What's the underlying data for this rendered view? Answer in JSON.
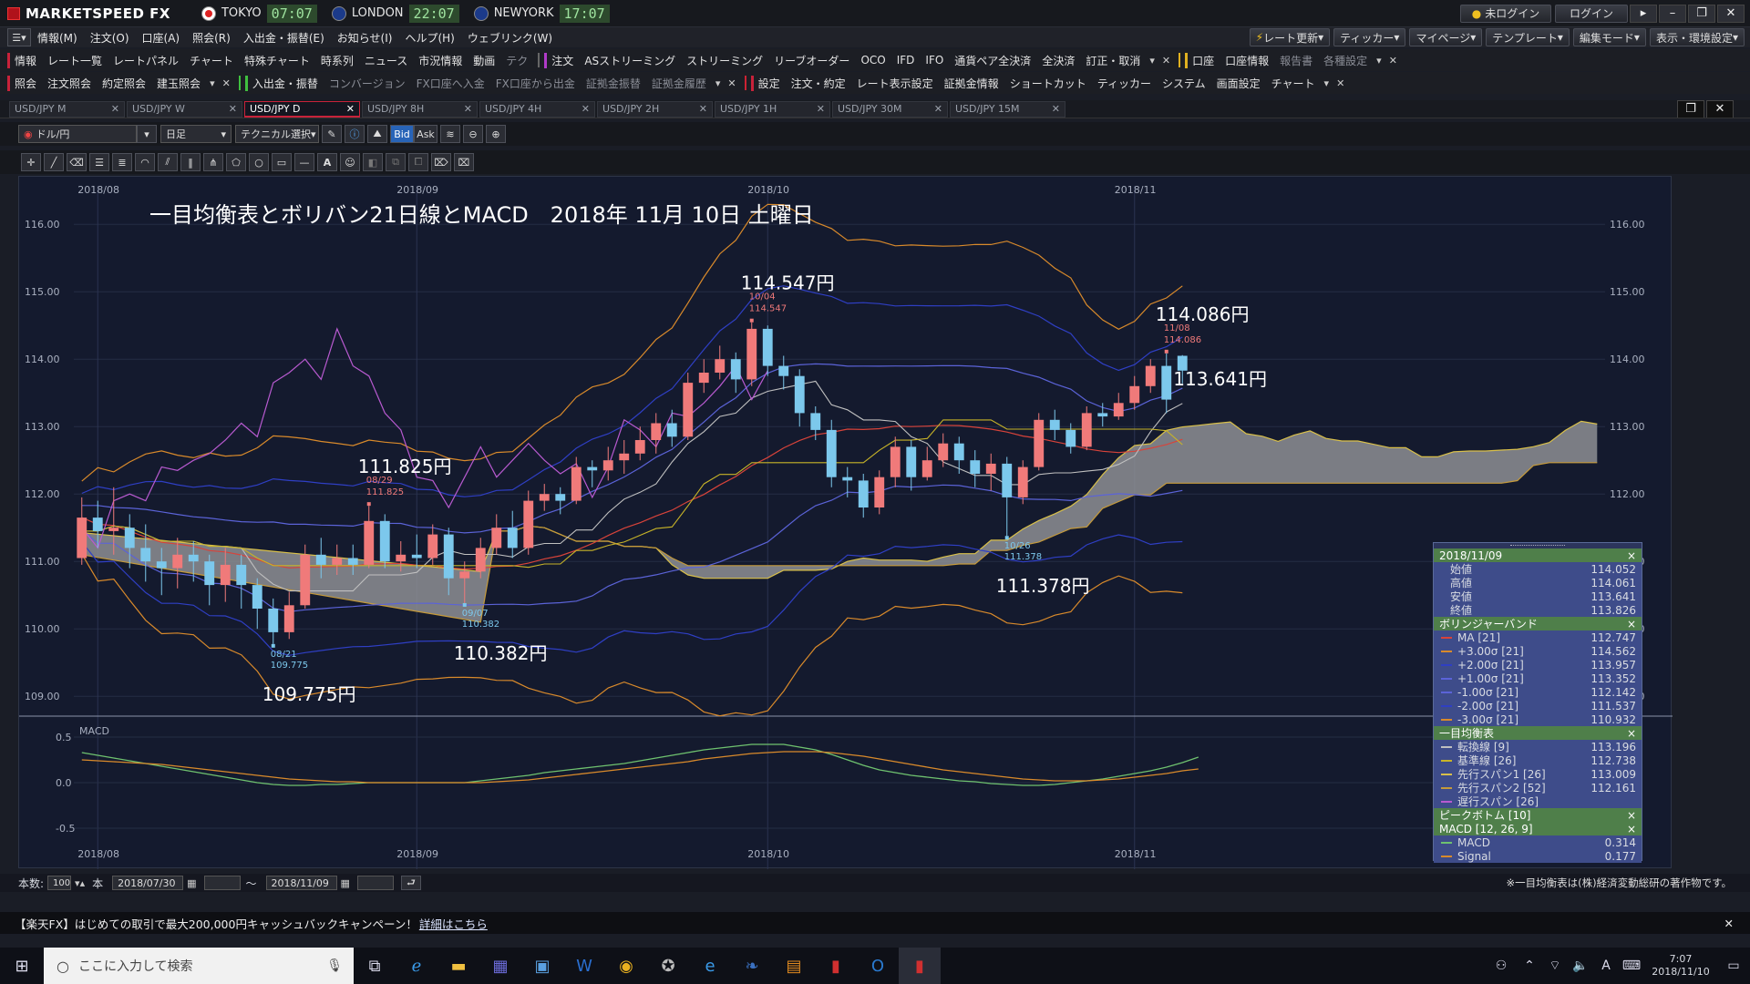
{
  "app": {
    "brand": "MARKETSPEED FX",
    "clocks": [
      {
        "city": "TOKYO",
        "time": "07:07",
        "color": "#ffffff"
      },
      {
        "city": "LONDON",
        "time": "22:07",
        "color": "#1b3a8a"
      },
      {
        "city": "NEWYORK",
        "time": "17:07",
        "color": "#1b3a8a"
      }
    ],
    "status": "未ログイン",
    "login": "ログイン"
  },
  "menu": [
    "情報(M)",
    "注文(O)",
    "口座(A)",
    "照会(R)",
    "入出金・振替(E)",
    "お知らせ(I)",
    "ヘルプ(H)",
    "ウェブリンク(W)"
  ],
  "right_menu": [
    "レート更新",
    "ティッカー",
    "マイページ",
    "テンプレート",
    "編集モード",
    "表示・環境設定"
  ],
  "toolbar1": {
    "g1": [
      "情報",
      "レート一覧",
      "レートパネル",
      "チャート",
      "特殊チャート",
      "時系列",
      "ニュース",
      "市況情報",
      "動画",
      "テク"
    ],
    "g2": [
      "注文",
      "ASストリーミング",
      "ストリーミング",
      "リーブオーダー",
      "OCO",
      "IFD",
      "IFO",
      "通貨ペア全決済",
      "全決済",
      "訂正・取消"
    ],
    "g3": [
      "口座",
      "口座情報",
      "報告書",
      "各種設定"
    ]
  },
  "toolbar2": {
    "g1": [
      "照会",
      "注文照会",
      "約定照会",
      "建玉照会"
    ],
    "g2": [
      "入出金・振替",
      "コンバージョン",
      "FX口座へ入金",
      "FX口座から出金",
      "証拠金振替",
      "証拠金履歴"
    ],
    "g3": [
      "設定",
      "注文・約定",
      "レート表示設定",
      "証拠金情報",
      "ショートカット",
      "ティッカー",
      "システム",
      "画面設定",
      "チャート"
    ]
  },
  "tabs": [
    "USD/JPY M",
    "USD/JPY W",
    "USD/JPY D",
    "USD/JPY 8H",
    "USD/JPY 4H",
    "USD/JPY 2H",
    "USD/JPY 1H",
    "USD/JPY 30M",
    "USD/JPY 15M"
  ],
  "active_tab": 2,
  "controls": {
    "pair": "ドル/円",
    "period": "日足",
    "technical": "テクニカル選択",
    "bid": "Bid",
    "ask": "Ask"
  },
  "chart_data": {
    "type": "candlestick",
    "title": "一目均衡表とボリバン21日線とMACD　2018年 11月 10日 土曜日",
    "x_labels": [
      "2018/08",
      "2018/09",
      "2018/10",
      "2018/11"
    ],
    "y_ticks": [
      "116.00",
      "115.00",
      "114.00",
      "113.00",
      "112.00",
      "111.00",
      "110.00",
      "109.00"
    ],
    "ylim": [
      108.8,
      116.3
    ],
    "macd_ticks": [
      "0.5",
      "0.0",
      "-0.5"
    ],
    "macd_label": "MACD",
    "annotations": [
      {
        "label": "114.547円",
        "date": "10/04",
        "value": "114.547",
        "kind": "high"
      },
      {
        "label": "114.086円",
        "date": "11/08",
        "value": "114.086",
        "kind": "high"
      },
      {
        "label": "113.641円",
        "value": "113.641",
        "kind": "price"
      },
      {
        "label": "111.825円",
        "date": "08/29",
        "value": "111.825",
        "kind": "high"
      },
      {
        "label": "111.378円",
        "date": "10/26",
        "value": "111.378",
        "kind": "low"
      },
      {
        "label": "110.382円",
        "date": "09/07",
        "value": "110.382",
        "kind": "low"
      },
      {
        "label": "109.775円",
        "date": "08/21",
        "value": "109.775",
        "kind": "low"
      }
    ],
    "candles": [
      [
        111.05,
        111.65,
        111.95,
        110.95
      ],
      [
        111.65,
        111.45,
        111.9,
        111.2
      ],
      [
        111.45,
        111.5,
        112.1,
        111.1
      ],
      [
        111.5,
        111.2,
        111.7,
        110.9
      ],
      [
        111.2,
        111.0,
        111.55,
        110.7
      ],
      [
        111.0,
        110.9,
        111.2,
        110.5
      ],
      [
        110.9,
        111.1,
        111.35,
        110.6
      ],
      [
        111.1,
        111.0,
        111.3,
        110.7
      ],
      [
        111.0,
        110.65,
        111.1,
        110.35
      ],
      [
        110.65,
        110.95,
        111.2,
        110.4
      ],
      [
        110.95,
        110.65,
        111.1,
        110.3
      ],
      [
        110.65,
        110.3,
        110.75,
        110.0
      ],
      [
        110.3,
        109.95,
        110.45,
        109.775
      ],
      [
        109.95,
        110.35,
        110.55,
        109.85
      ],
      [
        110.35,
        111.1,
        111.25,
        110.3
      ],
      [
        111.1,
        110.95,
        111.35,
        110.75
      ],
      [
        110.95,
        111.05,
        111.25,
        110.8
      ],
      [
        111.05,
        110.95,
        111.25,
        110.8
      ],
      [
        110.95,
        111.6,
        111.825,
        110.9
      ],
      [
        111.6,
        111.0,
        111.7,
        110.9
      ],
      [
        111.0,
        111.1,
        111.3,
        110.85
      ],
      [
        111.1,
        111.05,
        111.4,
        110.9
      ],
      [
        111.05,
        111.4,
        111.55,
        110.95
      ],
      [
        111.4,
        110.75,
        111.5,
        110.5
      ],
      [
        110.75,
        110.85,
        111.0,
        110.382
      ],
      [
        110.85,
        111.2,
        111.35,
        110.75
      ],
      [
        111.2,
        111.5,
        111.7,
        111.1
      ],
      [
        111.5,
        111.2,
        111.75,
        111.05
      ],
      [
        111.2,
        111.9,
        112.05,
        111.1
      ],
      [
        111.9,
        112.0,
        112.15,
        111.75
      ],
      [
        112.0,
        111.9,
        112.1,
        111.7
      ],
      [
        111.9,
        112.4,
        112.55,
        111.85
      ],
      [
        112.4,
        112.35,
        112.5,
        112.1
      ],
      [
        112.35,
        112.5,
        112.7,
        112.2
      ],
      [
        112.5,
        112.6,
        112.8,
        112.3
      ],
      [
        112.6,
        112.8,
        113.0,
        112.5
      ],
      [
        112.8,
        113.05,
        113.2,
        112.6
      ],
      [
        113.05,
        112.85,
        113.25,
        112.7
      ],
      [
        112.85,
        113.65,
        113.8,
        112.8
      ],
      [
        113.65,
        113.8,
        114.0,
        113.5
      ],
      [
        113.8,
        114.0,
        114.2,
        113.7
      ],
      [
        114.0,
        113.7,
        114.1,
        113.5
      ],
      [
        113.7,
        114.45,
        114.547,
        113.6
      ],
      [
        114.45,
        113.9,
        114.5,
        113.75
      ],
      [
        113.9,
        113.75,
        114.05,
        113.55
      ],
      [
        113.75,
        113.2,
        113.85,
        113.0
      ],
      [
        113.2,
        112.95,
        113.3,
        112.8
      ],
      [
        112.95,
        112.25,
        113.1,
        112.1
      ],
      [
        112.25,
        112.2,
        112.4,
        111.95
      ],
      [
        112.2,
        111.8,
        112.3,
        111.65
      ],
      [
        111.8,
        112.25,
        112.35,
        111.7
      ],
      [
        112.25,
        112.7,
        112.85,
        112.1
      ],
      [
        112.7,
        112.25,
        112.8,
        112.05
      ],
      [
        112.25,
        112.5,
        112.7,
        112.2
      ],
      [
        112.5,
        112.75,
        112.9,
        112.4
      ],
      [
        112.75,
        112.5,
        112.85,
        112.3
      ],
      [
        112.5,
        112.3,
        112.65,
        112.1
      ],
      [
        112.3,
        112.45,
        112.6,
        112.05
      ],
      [
        112.45,
        111.95,
        112.55,
        111.378
      ],
      [
        111.95,
        112.4,
        112.5,
        111.85
      ],
      [
        112.4,
        113.1,
        113.2,
        112.35
      ],
      [
        113.1,
        112.95,
        113.25,
        112.8
      ],
      [
        112.95,
        112.7,
        113.05,
        112.6
      ],
      [
        112.7,
        113.2,
        113.3,
        112.65
      ],
      [
        113.2,
        113.15,
        113.35,
        113.0
      ],
      [
        113.15,
        113.35,
        113.5,
        113.1
      ],
      [
        113.35,
        113.6,
        113.75,
        113.25
      ],
      [
        113.6,
        113.9,
        114.0,
        113.5
      ],
      [
        113.9,
        113.4,
        114.086,
        113.2
      ],
      [
        114.05,
        113.83,
        114.06,
        113.64
      ]
    ],
    "macd": [
      0.33,
      0.3,
      0.27,
      0.24,
      0.21,
      0.18,
      0.15,
      0.12,
      0.09,
      0.06,
      0.03,
      0.0,
      -0.02,
      -0.03,
      -0.03,
      -0.02,
      -0.02,
      -0.01,
      0.0,
      0.0,
      0.0,
      0.0,
      0.0,
      0.0,
      0.0,
      0.02,
      0.04,
      0.06,
      0.08,
      0.11,
      0.13,
      0.15,
      0.17,
      0.19,
      0.21,
      0.24,
      0.27,
      0.3,
      0.33,
      0.36,
      0.38,
      0.4,
      0.42,
      0.42,
      0.42,
      0.39,
      0.36,
      0.31,
      0.25,
      0.19,
      0.14,
      0.11,
      0.08,
      0.06,
      0.04,
      0.02,
      0.01,
      -0.01,
      -0.02,
      -0.03,
      -0.03,
      -0.02,
      0.0,
      0.02,
      0.04,
      0.07,
      0.1,
      0.13,
      0.17,
      0.22,
      0.28
    ],
    "signal": [
      0.25,
      0.24,
      0.23,
      0.22,
      0.21,
      0.2,
      0.18,
      0.16,
      0.14,
      0.12,
      0.1,
      0.08,
      0.06,
      0.04,
      0.03,
      0.02,
      0.01,
      0.01,
      0.0,
      0.0,
      0.0,
      0.0,
      0.0,
      0.0,
      0.0,
      0.0,
      0.01,
      0.02,
      0.03,
      0.05,
      0.07,
      0.09,
      0.11,
      0.13,
      0.15,
      0.17,
      0.19,
      0.21,
      0.23,
      0.26,
      0.28,
      0.3,
      0.32,
      0.33,
      0.34,
      0.34,
      0.34,
      0.33,
      0.31,
      0.29,
      0.26,
      0.23,
      0.2,
      0.17,
      0.14,
      0.12,
      0.1,
      0.08,
      0.06,
      0.04,
      0.03,
      0.02,
      0.02,
      0.02,
      0.03,
      0.04,
      0.06,
      0.08,
      0.1,
      0.13,
      0.15
    ],
    "bands_colors": {
      "mid": "#d8433a",
      "s1": "#5b63d8",
      "s2": "#2f3fc4",
      "s3": "#d98a2b",
      "tenkan": "#c0c0c0",
      "kijun": "#c8b428",
      "chikou": "#b85ad0"
    }
  },
  "info_panel": {
    "date": "2018/11/09",
    "ohlc": [
      {
        "k": "始値",
        "v": "114.052"
      },
      {
        "k": "高値",
        "v": "114.061"
      },
      {
        "k": "安値",
        "v": "113.641"
      },
      {
        "k": "終値",
        "v": "113.826"
      }
    ],
    "bb_title": "ボリンジャーバンド",
    "bb": [
      {
        "k": "MA [21]",
        "v": "112.747",
        "c": "#d8433a"
      },
      {
        "k": "+3.00σ [21]",
        "v": "114.562",
        "c": "#d98a2b"
      },
      {
        "k": "+2.00σ [21]",
        "v": "113.957",
        "c": "#2f3fc4"
      },
      {
        "k": "+1.00σ [21]",
        "v": "113.352",
        "c": "#5b63d8"
      },
      {
        "k": "-1.00σ [21]",
        "v": "112.142",
        "c": "#5b63d8"
      },
      {
        "k": "-2.00σ [21]",
        "v": "111.537",
        "c": "#2f3fc4"
      },
      {
        "k": "-3.00σ [21]",
        "v": "110.932",
        "c": "#d98a2b"
      }
    ],
    "ichi_title": "一目均衡表",
    "ichi": [
      {
        "k": "転換線 [9]",
        "v": "113.196",
        "c": "#c0c0c0"
      },
      {
        "k": "基準線 [26]",
        "v": "112.738",
        "c": "#c8b428"
      },
      {
        "k": "先行スパン1 [26]",
        "v": "113.009",
        "c": "#d9c04a"
      },
      {
        "k": "先行スパン2 [52]",
        "v": "112.161",
        "c": "#c59a3a"
      },
      {
        "k": "遅行スパン [26]",
        "v": "",
        "c": "#b85ad0"
      }
    ],
    "peak_title": "ピークボトム [10]",
    "macd_title": "MACD [12, 26, 9]",
    "macd": [
      {
        "k": "MACD",
        "v": "0.314",
        "c": "#6fc26f"
      },
      {
        "k": "Signal",
        "v": "0.177",
        "c": "#d98a2b"
      }
    ]
  },
  "bottom": {
    "count_label": "本数:",
    "count": "100",
    "unit": "本",
    "from": "2018/07/30",
    "to": "2018/11/09",
    "tilde": "～",
    "copyright": "※一目均衡表は(株)経済変動総研の著作物です。"
  },
  "banner": {
    "text": "【楽天FX】はじめての取引で最大200,000円キャッシュバックキャンペーン！",
    "link": "詳細はこちら"
  },
  "taskbar": {
    "search": "ここに入力して検索",
    "time": "7:07",
    "date": "2018/11/10",
    "ime": "A"
  }
}
